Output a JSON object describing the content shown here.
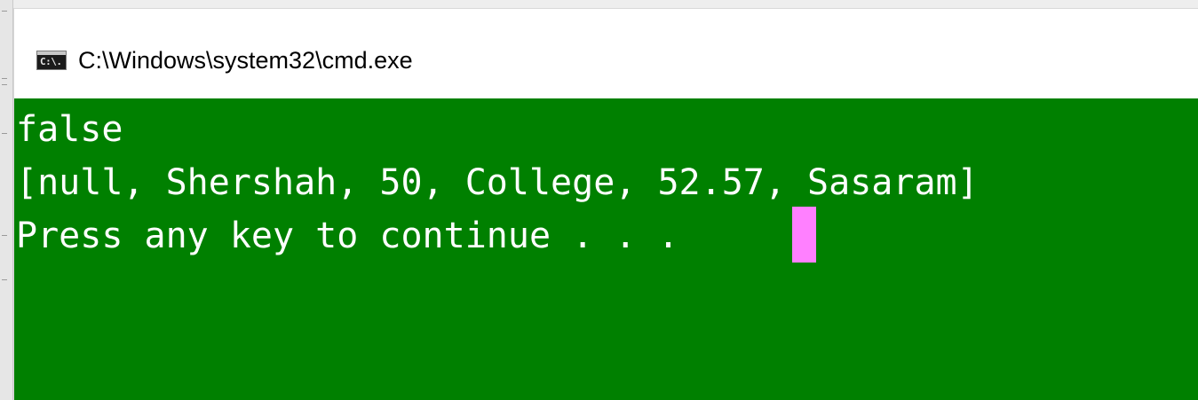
{
  "window": {
    "title": "C:\\Windows\\system32\\cmd.exe",
    "icon": "cmd-icon",
    "icon_glyph": "C:\\."
  },
  "console": {
    "background": "#008000",
    "text_color": "#ffffff",
    "cursor_color": "#ff80ff",
    "lines": [
      "false",
      "[null, Shershah, 50, College, 52.57, Sasaram]",
      "Press any key to continue . . . "
    ]
  }
}
